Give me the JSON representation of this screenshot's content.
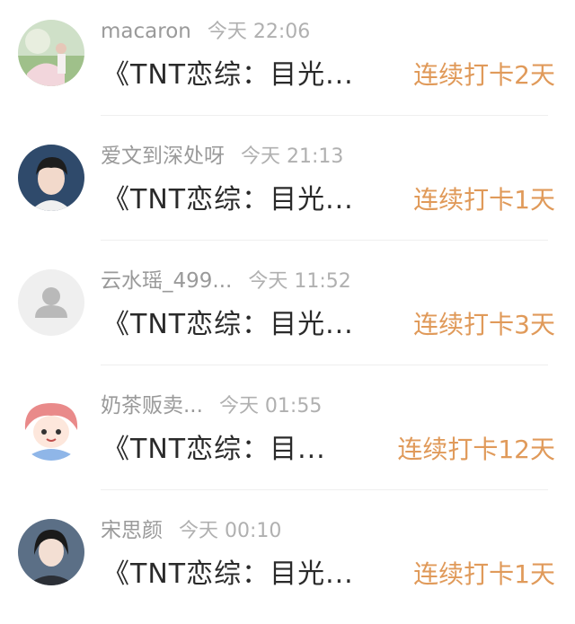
{
  "messages": [
    {
      "user": "macaron",
      "time": "今天 22:06",
      "text": "《TNT恋综：目光...",
      "streak": "连续打卡2天",
      "avatar": "landscape-photo-avatar"
    },
    {
      "user": "爱文到深处呀",
      "time": "今天 21:13",
      "text": "《TNT恋综：目光...",
      "streak": "连续打卡1天",
      "avatar": "young-man-photo-avatar"
    },
    {
      "user": "云水瑶_499...",
      "time": "今天 11:52",
      "text": "《TNT恋综：目光...",
      "streak": "连续打卡3天",
      "avatar": "default-person-avatar"
    },
    {
      "user": "奶茶贩卖...",
      "time": "今天 01:55",
      "text": "《TNT恋综：目...",
      "streak": "连续打卡12天",
      "avatar": "anime-girl-avatar"
    },
    {
      "user": "宋思颜",
      "time": "今天 00:10",
      "text": "《TNT恋综：目光...",
      "streak": "连续打卡1天",
      "avatar": "portrait-photo-avatar"
    }
  ],
  "colors": {
    "accent": "#e09a5a",
    "name": "#9a9a9a",
    "text": "#2a2a2a"
  }
}
